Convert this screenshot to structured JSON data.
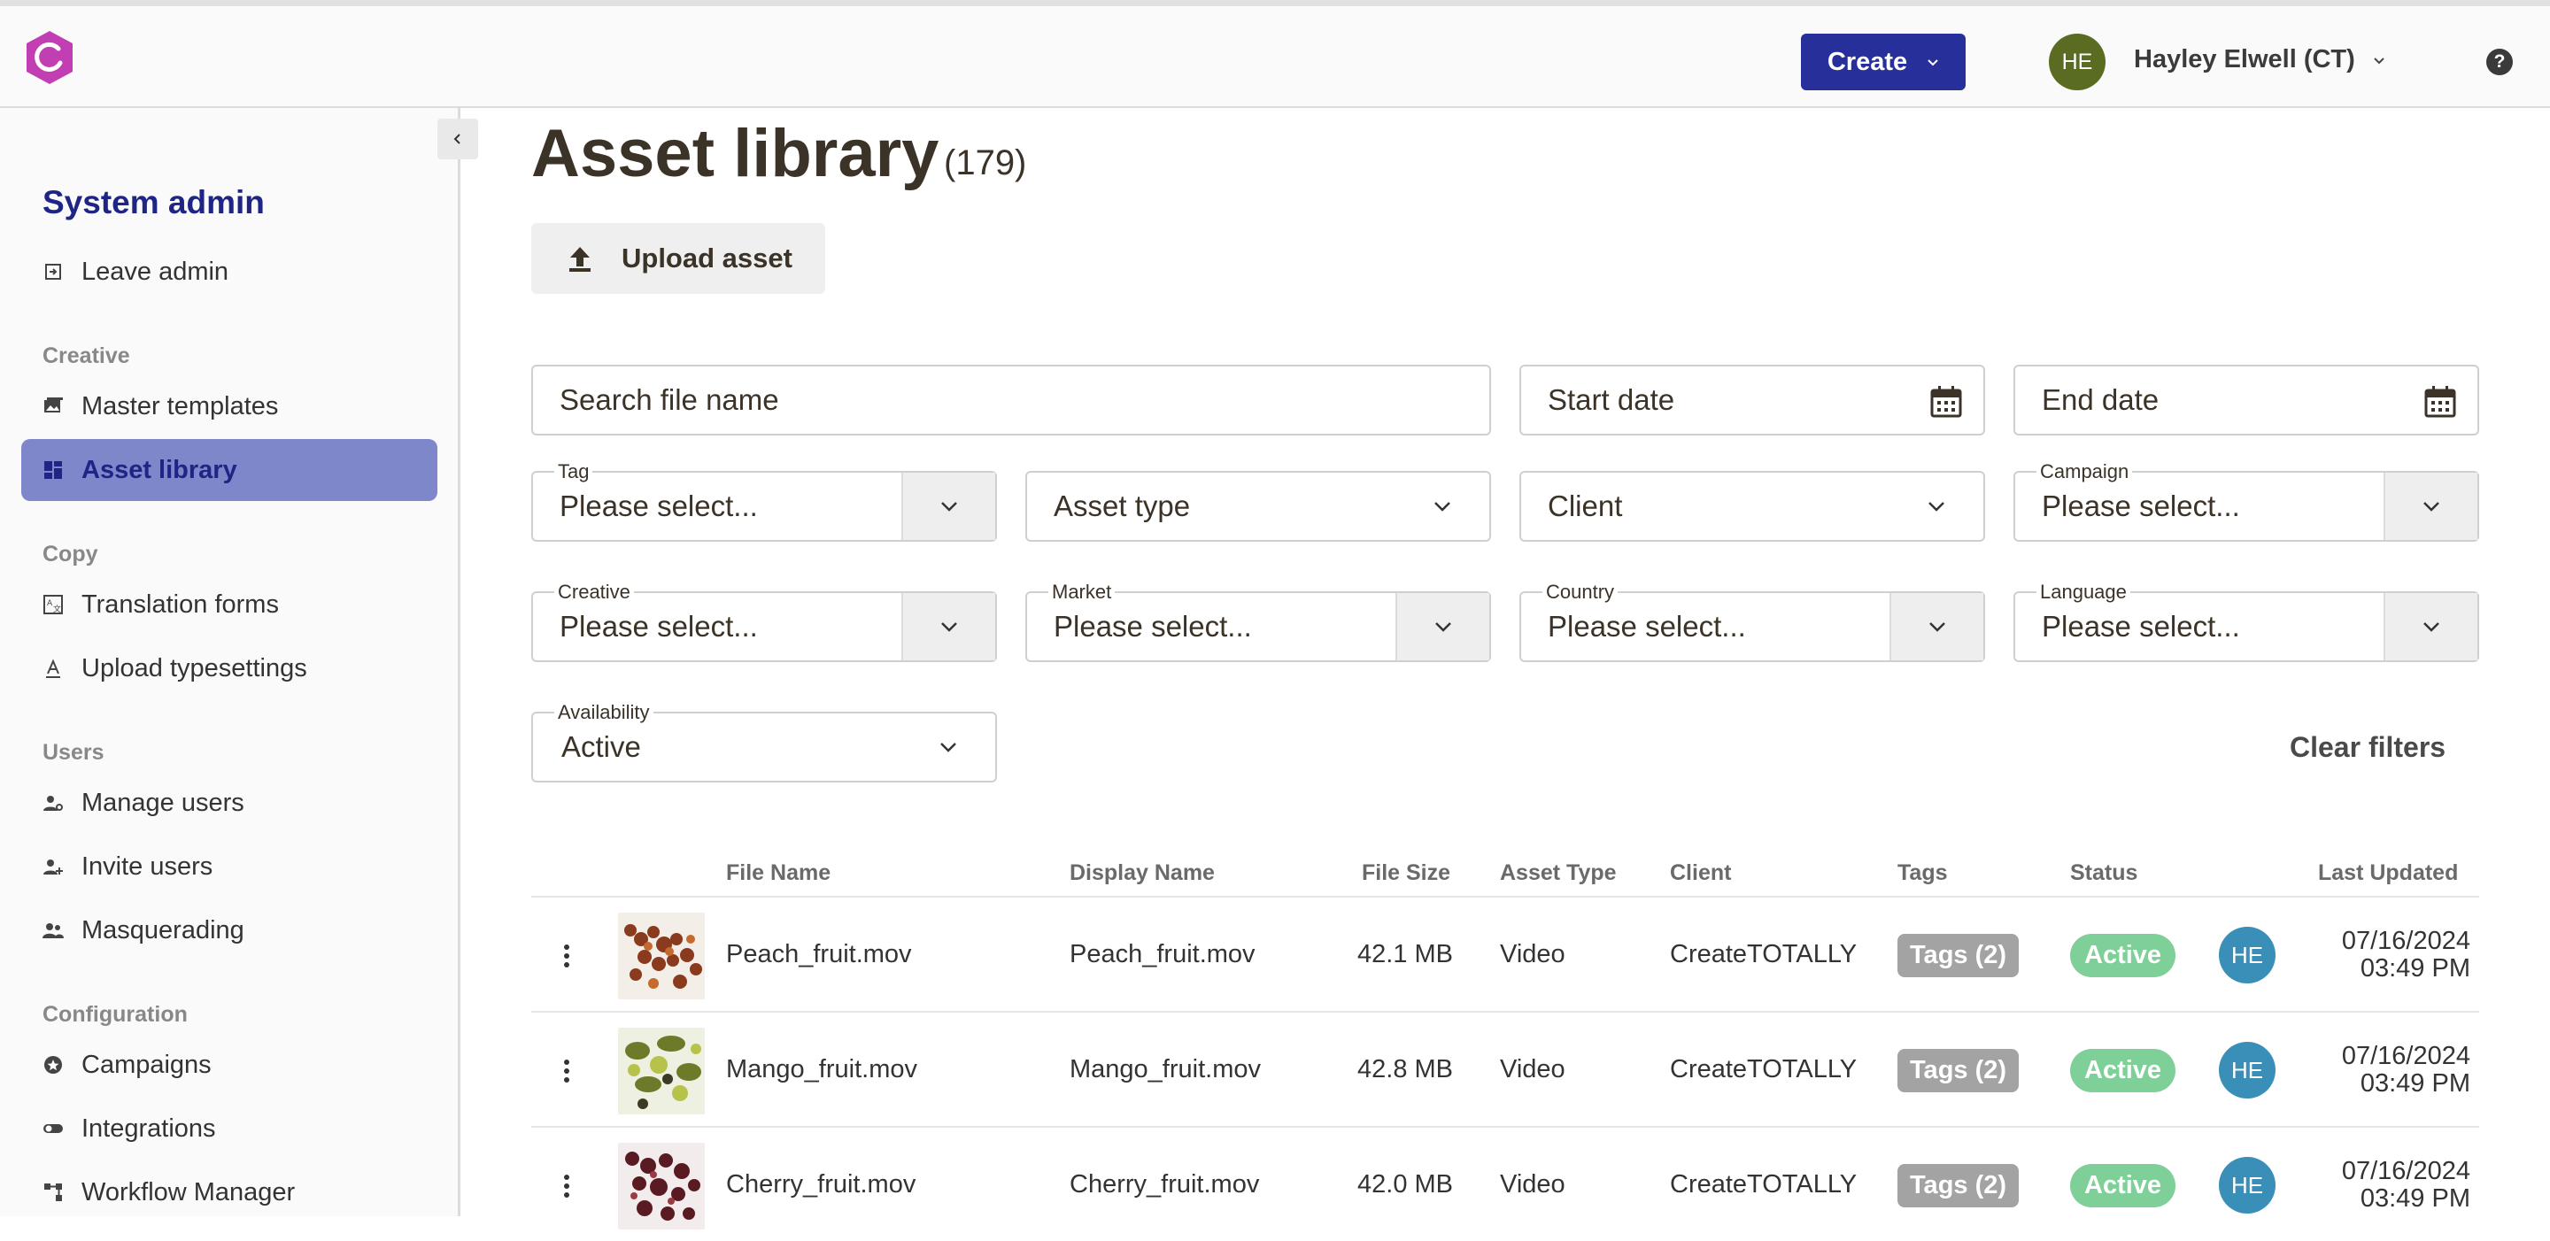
{
  "header": {
    "create_label": "Create",
    "user_initials": "HE",
    "user_name": "Hayley Elwell (CT)",
    "help_label": "?"
  },
  "sidebar": {
    "title": "System admin",
    "leave_admin": "Leave admin",
    "sections": {
      "creative": "Creative",
      "copy": "Copy",
      "users": "Users",
      "configuration": "Configuration"
    },
    "items": {
      "master_templates": "Master templates",
      "asset_library": "Asset library",
      "translation_forms": "Translation forms",
      "upload_typesettings": "Upload typesettings",
      "manage_users": "Manage users",
      "invite_users": "Invite users",
      "masquerading": "Masquerading",
      "campaigns": "Campaigns",
      "integrations": "Integrations",
      "workflow_manager": "Workflow Manager"
    }
  },
  "page": {
    "title": "Asset library",
    "count": "(179)",
    "upload_label": "Upload asset"
  },
  "filters": {
    "search_placeholder": "Search file name",
    "start_date": "Start date",
    "end_date": "End date",
    "tag_label": "Tag",
    "tag_value": "Please select...",
    "asset_type": "Asset type",
    "client": "Client",
    "campaign_label": "Campaign",
    "campaign_value": "Please select...",
    "creative_label": "Creative",
    "creative_value": "Please select...",
    "market_label": "Market",
    "market_value": "Please select...",
    "country_label": "Country",
    "country_value": "Please select...",
    "language_label": "Language",
    "language_value": "Please select...",
    "availability_label": "Availability",
    "availability_value": "Active",
    "clear_label": "Clear filters"
  },
  "table": {
    "headers": {
      "file_name": "File Name",
      "display_name": "Display Name",
      "file_size": "File Size",
      "asset_type": "Asset Type",
      "client": "Client",
      "tags": "Tags",
      "status": "Status",
      "last_updated": "Last Updated"
    },
    "rows": [
      {
        "file_name": "Peach_fruit.mov",
        "display_name": "Peach_fruit.mov",
        "file_size": "42.1 MB",
        "asset_type": "Video",
        "client": "CreateTOTALLY",
        "tags": "Tags (2)",
        "status": "Active",
        "initials": "HE",
        "date": "07/16/2024",
        "time": "03:49 PM"
      },
      {
        "file_name": "Mango_fruit.mov",
        "display_name": "Mango_fruit.mov",
        "file_size": "42.8 MB",
        "asset_type": "Video",
        "client": "CreateTOTALLY",
        "tags": "Tags (2)",
        "status": "Active",
        "initials": "HE",
        "date": "07/16/2024",
        "time": "03:49 PM"
      },
      {
        "file_name": "Cherry_fruit.mov",
        "display_name": "Cherry_fruit.mov",
        "file_size": "42.0 MB",
        "asset_type": "Video",
        "client": "CreateTOTALLY",
        "tags": "Tags (2)",
        "status": "Active",
        "initials": "HE",
        "date": "07/16/2024",
        "time": "03:49 PM"
      }
    ]
  },
  "colors": {
    "brand": "#c13fb3",
    "primary": "#27309a",
    "active_nav": "#7d87c9",
    "status_active": "#7ecf98",
    "tag_pill": "#a3a3a3",
    "avatar_user": "#5a6b22",
    "avatar_row": "#3a8fb8"
  }
}
